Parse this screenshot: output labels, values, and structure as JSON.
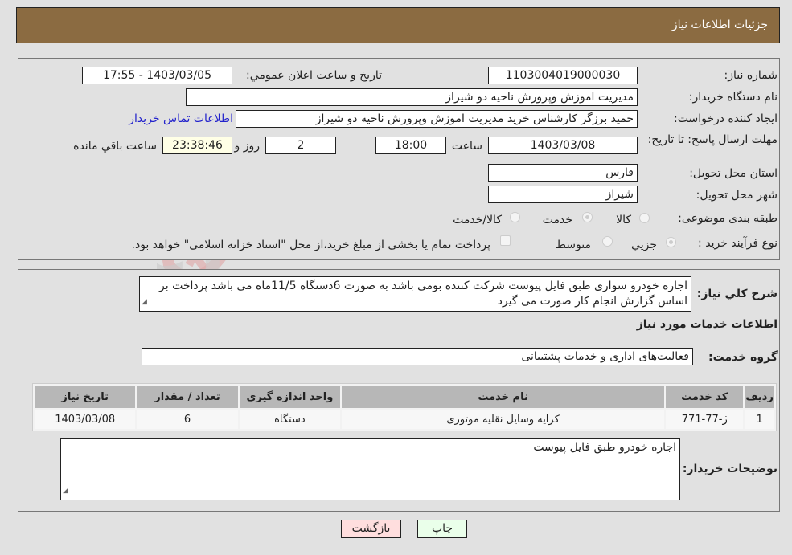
{
  "header": {
    "title": "جزئیات اطلاعات نیاز"
  },
  "form": {
    "need_number": {
      "label": "شماره نیاز:",
      "value": "1103004019000030"
    },
    "announce_datetime": {
      "label": "تاریخ و ساعت اعلان عمومي:",
      "value": "1403/03/05 - 17:55"
    },
    "buyer_org": {
      "label": "نام دستگاه خریدار:",
      "value": "مدیریت اموزش وپرورش ناحیه دو شیراز"
    },
    "requester": {
      "label": "ایجاد کننده درخواست:",
      "value": "حمید برزگر کارشناس خرید مدیریت اموزش وپرورش ناحیه دو شیراز"
    },
    "buyer_contact_link": "اطلاعات تماس خریدار",
    "deadline": {
      "label": "مهلت ارسال پاسخ: تا تاریخ:",
      "date": "1403/03/08",
      "time_label": "ساعت",
      "time": "18:00",
      "days": "2",
      "days_label": "روز و",
      "remaining": "23:38:46",
      "remaining_label": "ساعت باقي مانده"
    },
    "province": {
      "label": "استان محل تحویل:",
      "value": "فارس"
    },
    "city": {
      "label": "شهر محل تحویل:",
      "value": "شیراز"
    },
    "category": {
      "label": "طبقه بندی موضوعی:",
      "options": [
        "کالا",
        "خدمت",
        "کالا/خدمت"
      ],
      "selected": "خدمت"
    },
    "purchase_type": {
      "label": "نوع فرآیند خرید :",
      "options": [
        "جزيي",
        "متوسط"
      ],
      "selected": "جزيي",
      "treasury_note": "پرداخت تمام یا بخشی از مبلغ خرید،از محل \"اسناد خزانه اسلامی\" خواهد بود."
    }
  },
  "details": {
    "summary_label": "شرح كلي نياز:",
    "summary_text": "اجاره خودرو سواری طبق فایل پیوست شرکت کننده بومی باشد به صورت 6دستگاه 11/5ماه می باشد پرداخت بر اساس گزارش انجام کار صورت می گیرد",
    "services_heading": "اطلاعات خدمات مورد نیاز",
    "service_group_label": "گروه خدمت:",
    "service_group_value": "فعالیت‌های اداری و خدمات پشتیبانی",
    "table": {
      "headers": [
        "ردیف",
        "کد خدمت",
        "نام خدمت",
        "واحد اندازه گیری",
        "تعداد / مقدار",
        "تاریخ نیاز"
      ],
      "rows": [
        [
          "1",
          "ژ-77-771",
          "کرایه وسایل نقلیه موتوری",
          "دستگاه",
          "6",
          "1403/03/08"
        ]
      ]
    },
    "buyer_notes_label": "توضیحات خریدار:",
    "buyer_notes_text": "اجاره خودرو طبق فایل پیوست"
  },
  "buttons": {
    "print": "چاپ",
    "back": "بازگشت"
  },
  "colors": {
    "header_bg": "#8b6b41",
    "print_bg": "#eaffea",
    "back_bg": "#ffdede",
    "link": "#2222cc"
  },
  "watermark": {
    "text": "AriaTender.neT"
  }
}
